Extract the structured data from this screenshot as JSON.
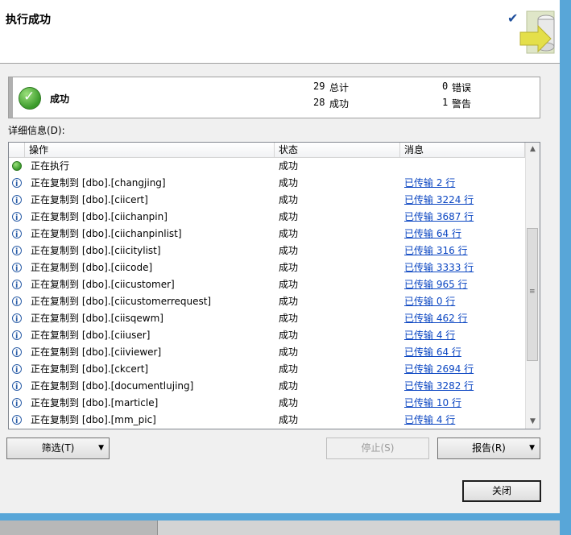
{
  "header": {
    "title": "执行成功"
  },
  "summary": {
    "status": "成功",
    "total_count": "29",
    "total_label": "总计",
    "success_count": "28",
    "success_label": "成功",
    "error_count": "0",
    "error_label": "错误",
    "warning_count": "1",
    "warning_label": "警告"
  },
  "details_label": "详细信息(D):",
  "columns": {
    "operation": "操作",
    "status": "状态",
    "message": "消息"
  },
  "rows": [
    {
      "icon": "success",
      "operation": "正在执行",
      "status": "成功",
      "message": ""
    },
    {
      "icon": "info",
      "operation": "正在复制到 [dbo].[changjing]",
      "status": "成功",
      "message": "已传输 2 行"
    },
    {
      "icon": "info",
      "operation": "正在复制到 [dbo].[ciicert]",
      "status": "成功",
      "message": "已传输 3224 行"
    },
    {
      "icon": "info",
      "operation": "正在复制到 [dbo].[ciichanpin]",
      "status": "成功",
      "message": "已传输 3687 行"
    },
    {
      "icon": "info",
      "operation": "正在复制到 [dbo].[ciichanpinlist]",
      "status": "成功",
      "message": "已传输 64 行"
    },
    {
      "icon": "info",
      "operation": "正在复制到 [dbo].[ciicitylist]",
      "status": "成功",
      "message": "已传输 316 行"
    },
    {
      "icon": "info",
      "operation": "正在复制到 [dbo].[ciicode]",
      "status": "成功",
      "message": "已传输 3333 行"
    },
    {
      "icon": "info",
      "operation": "正在复制到 [dbo].[ciicustomer]",
      "status": "成功",
      "message": "已传输 965 行"
    },
    {
      "icon": "info",
      "operation": "正在复制到 [dbo].[ciicustomerrequest]",
      "status": "成功",
      "message": "已传输 0 行"
    },
    {
      "icon": "info",
      "operation": "正在复制到 [dbo].[ciisqewm]",
      "status": "成功",
      "message": "已传输 462 行"
    },
    {
      "icon": "info",
      "operation": "正在复制到 [dbo].[ciiuser]",
      "status": "成功",
      "message": "已传输 4 行"
    },
    {
      "icon": "info",
      "operation": "正在复制到 [dbo].[ciiviewer]",
      "status": "成功",
      "message": "已传输 64 行"
    },
    {
      "icon": "info",
      "operation": "正在复制到 [dbo].[ckcert]",
      "status": "成功",
      "message": "已传输 2694 行"
    },
    {
      "icon": "info",
      "operation": "正在复制到 [dbo].[documentlujing]",
      "status": "成功",
      "message": "已传输 3282 行"
    },
    {
      "icon": "info",
      "operation": "正在复制到 [dbo].[marticle]",
      "status": "成功",
      "message": "已传输 10 行"
    },
    {
      "icon": "info",
      "operation": "正在复制到 [dbo].[mm_pic]",
      "status": "成功",
      "message": "已传输 4 行"
    }
  ],
  "buttons": {
    "filter": "筛选(T)",
    "stop": "停止(S)",
    "report": "报告(R)",
    "close": "关闭"
  }
}
